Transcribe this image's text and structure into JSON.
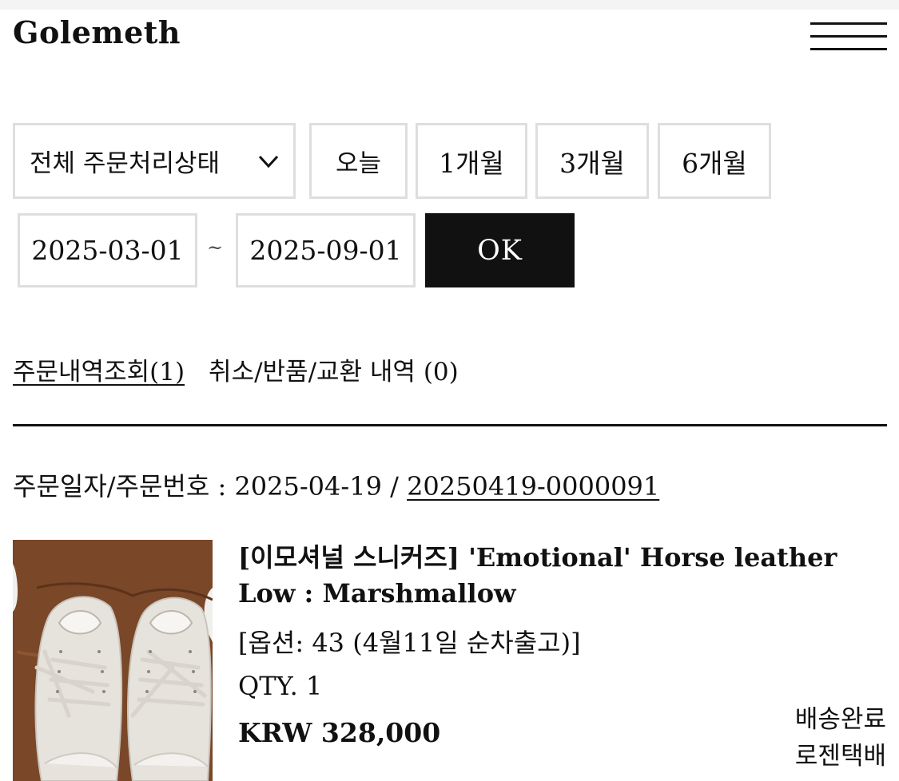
{
  "header": {
    "logo": "Golemeth",
    "menu_icon": "hamburger-menu-icon"
  },
  "filters": {
    "status_select": {
      "value": "전체 주문처리상태",
      "icon": "chevron-down-icon"
    },
    "period_buttons": [
      "오늘",
      "1개월",
      "3개월",
      "6개월"
    ],
    "date_from": "2025-03-01",
    "date_separator": "~",
    "date_to": "2025-09-01",
    "submit_label": "OK"
  },
  "tabs": [
    {
      "label": "주문내역조회",
      "count": "(1)"
    },
    {
      "label": "취소/반품/교환 내역",
      "count": "(0)"
    }
  ],
  "order": {
    "label": "주문일자/주문번호 : 2025-04-19 / ",
    "order_number": "20250419-0000091",
    "product": {
      "name": "[이모셔널 스니커즈] 'Emotional' Horse leather Low : Marshmallow",
      "option": "[옵션: 43 (4월11일 순차출고)]",
      "qty": "QTY. 1",
      "price": "KRW 328,000"
    },
    "status": "배송완료",
    "carrier": "로젠택배"
  },
  "colors": {
    "text": "#111111",
    "border": "#dedede",
    "button_bg": "#111111",
    "button_text": "#ffffff"
  }
}
